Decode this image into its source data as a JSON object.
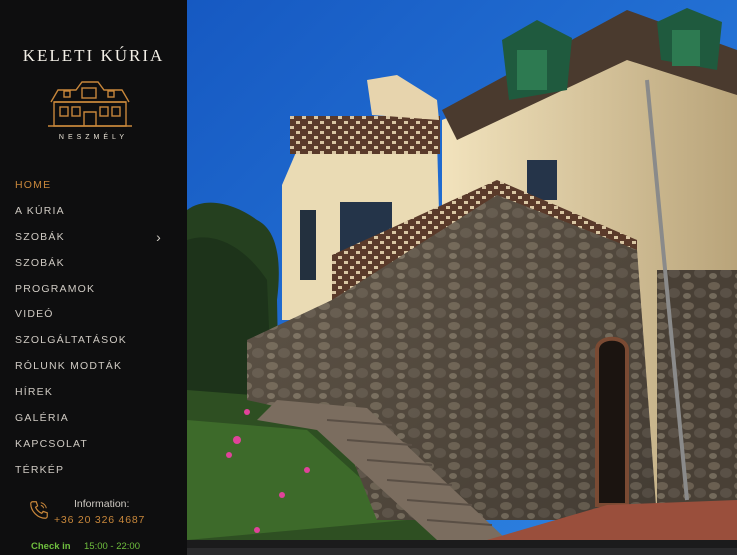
{
  "brand": {
    "title": "KELETI KÚRIA",
    "subtitle": "NESZMÉLY"
  },
  "nav": [
    {
      "label": "HOME",
      "active": true
    },
    {
      "label": "A KÚRIA"
    },
    {
      "label": "SZOBÁK",
      "has_submenu": true
    },
    {
      "label": "SZOBÁK"
    },
    {
      "label": "PROGRAMOK"
    },
    {
      "label": "VIDEÓ"
    },
    {
      "label": "SZOLGÁLTATÁSOK"
    },
    {
      "label": "RÓLUNK MODTÁK"
    },
    {
      "label": "HÍREK"
    },
    {
      "label": "GALÉRIA"
    },
    {
      "label": "KAPCSOLAT"
    },
    {
      "label": "TÉRKÉP"
    }
  ],
  "contact": {
    "label": "Information:",
    "phone": "+36 20 326 4687",
    "icon": "phone-icon"
  },
  "checkin": {
    "label": "Check in",
    "time": "15:00 - 22:00"
  },
  "colors": {
    "sidebar_bg": "#0e0e0f",
    "accent": "#c8873b",
    "checkin": "#6fbf3e",
    "sky": "#1f63c7"
  }
}
